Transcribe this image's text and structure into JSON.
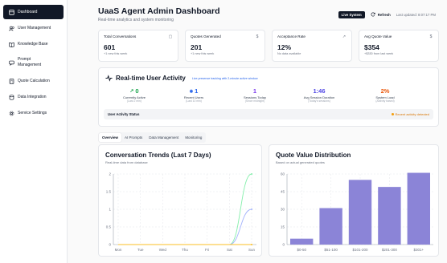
{
  "sidebar": {
    "items": [
      {
        "label": "Dashboard",
        "icon": "dashboard-icon",
        "active": true
      },
      {
        "label": "User Management",
        "icon": "users-icon",
        "active": false
      },
      {
        "label": "Knowledge Base",
        "icon": "book-icon",
        "active": false
      },
      {
        "label": "Prompt\nManagement",
        "icon": "message-icon",
        "active": false
      },
      {
        "label": "Quote Calculation",
        "icon": "calculator-icon",
        "active": false
      },
      {
        "label": "Data Integration",
        "icon": "database-icon",
        "active": false
      },
      {
        "label": "Service Settings",
        "icon": "gear-icon",
        "active": false
      }
    ]
  },
  "header": {
    "title": "UaaS Agent Admin Dashboard",
    "subtitle": "Real-time analytics and system monitoring",
    "live_label": "Live System",
    "refresh_label": "Refresh",
    "last_updated": "Last updated: 8:07:17 PM"
  },
  "stats": [
    {
      "label": "Total Conversations",
      "value": "601",
      "sub": "+1 new this week",
      "icon": "chat-icon",
      "glyph": "▢"
    },
    {
      "label": "Quotes Generated",
      "value": "201",
      "sub": "+1 new this week",
      "icon": "dollar-icon",
      "glyph": "$"
    },
    {
      "label": "Acceptance Rate",
      "value": "12%",
      "sub": "No data available",
      "icon": "trending-icon",
      "glyph": "↗"
    },
    {
      "label": "Avg Quote Value",
      "value": "$354",
      "sub": "+$330 from last week",
      "icon": "dollar-icon",
      "glyph": "$"
    }
  ],
  "activity": {
    "title": "Real-time User Activity",
    "note": "Live presence tracking with 2-minute active window",
    "metrics": [
      {
        "value": "0",
        "label": "Currently Active",
        "sub": "(Last 2 min)",
        "color": "#16a34a",
        "icon": "activity-icon",
        "glyph": "↗"
      },
      {
        "value": "1",
        "label": "Recent Users",
        "sub": "(Last 10 min)",
        "color": "#2563eb",
        "icon": "eye-icon",
        "glyph": "◉"
      },
      {
        "value": "1",
        "label": "Sessions Today",
        "sub": "(Since midnight)",
        "color": "#7c3aed",
        "icon": "",
        "glyph": ""
      },
      {
        "value": "1:46",
        "label": "Avg Session Duration",
        "sub": "(Today's sessions)",
        "color": "#4f46e5",
        "icon": "",
        "glyph": ""
      },
      {
        "value": "2%",
        "label": "System Load",
        "sub": "(Activity based)",
        "color": "#ea580c",
        "icon": "",
        "glyph": ""
      }
    ],
    "status_label": "User Activity Status",
    "status_text": "Recent activity detected",
    "status_color": "#f59e0b"
  },
  "tabs": [
    "Overview",
    "AI Prompts",
    "Data Management",
    "Monitoring"
  ],
  "active_tab": "Overview",
  "charts": {
    "trends": {
      "title": "Conversation Trends (Last 7 Days)",
      "subtitle": "Real-time data from database"
    },
    "quotes": {
      "title": "Quote Value Distribution",
      "subtitle": "Based on actual generated quotes"
    }
  },
  "chart_data": [
    {
      "type": "line",
      "title": "Conversation Trends (Last 7 Days)",
      "x": [
        "Mon",
        "Tue",
        "Wed",
        "Thu",
        "Fri",
        "Sat",
        "Sun"
      ],
      "yticks": [
        "0",
        "0.5",
        "1",
        "1.5",
        "2"
      ],
      "ylim": [
        0,
        2
      ],
      "series": [
        {
          "values": [
            0,
            0,
            0,
            0,
            0,
            0,
            2
          ],
          "color": "#86efac"
        },
        {
          "values": [
            0,
            0,
            0,
            0,
            0,
            0,
            1
          ],
          "color": "#a5b4fc"
        },
        {
          "values": [
            0,
            0,
            0,
            0,
            0,
            0,
            0
          ],
          "color": "#fbbf24"
        }
      ],
      "grid": true
    },
    {
      "type": "bar",
      "title": "Quote Value Distribution",
      "categories": [
        "$0-50",
        "$51-100",
        "$101-200",
        "$201-300",
        "$301+"
      ],
      "values": [
        5,
        31,
        55,
        49,
        61
      ],
      "yticks": [
        "0",
        "15",
        "30",
        "45",
        "60"
      ],
      "ylim": [
        0,
        60
      ],
      "color": "#8b84d7",
      "grid": true
    }
  ]
}
